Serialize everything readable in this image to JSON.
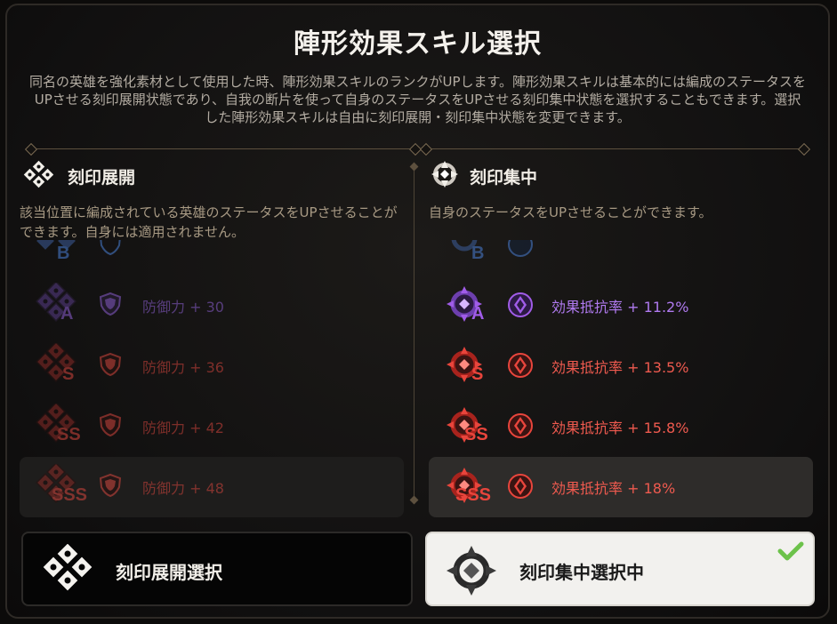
{
  "title": "陣形効果スキル選択",
  "description": "同名の英雄を強化素材として使用した時、陣形効果スキルのランクがUPします。陣形効果スキルは基本的には編成のステータスをUPさせる刻印展開状態であり、自我の断片を使って自身のステータスをUPさせる刻印集中状態を選択することもできます。選択した陣形効果スキルは自由に刻印展開・刻印集中状態を変更できます。",
  "left": {
    "label": "刻印展開",
    "icon": "diamond-cluster-icon",
    "desc": "該当位置に編成されている英雄のステータスをUPさせることができます。自身には適用されません。",
    "rows": [
      {
        "rank": "B",
        "stat": "",
        "color": "#4a7fd6",
        "partial": true
      },
      {
        "rank": "A",
        "stat": "防御力 + 30",
        "color": "#8d5fd3"
      },
      {
        "rank": "S",
        "stat": "防御力 + 36",
        "color": "#d4453d"
      },
      {
        "rank": "SS",
        "stat": "防御力 + 42",
        "color": "#d4453d"
      },
      {
        "rank": "SSS",
        "stat": "防御力 + 48",
        "color": "#d4453d",
        "selected": true
      }
    ]
  },
  "right": {
    "label": "刻印集中",
    "icon": "crosshair-icon",
    "desc": "自身のステータスをUPさせることができます。",
    "rows": [
      {
        "rank": "B",
        "stat": "",
        "color": "#4a7fd6",
        "partial": true
      },
      {
        "rank": "A",
        "stat": "効果抵抗率 + 11.2%",
        "color": "#a05ce8"
      },
      {
        "rank": "S",
        "stat": "効果抵抗率 + 13.5%",
        "color": "#e8453c"
      },
      {
        "rank": "SS",
        "stat": "効果抵抗率 + 15.8%",
        "color": "#e8453c"
      },
      {
        "rank": "SSS",
        "stat": "効果抵抗率 + 18%",
        "color": "#e8453c",
        "selected": true
      }
    ]
  },
  "buttons": {
    "left_label": "刻印展開選択",
    "right_label": "刻印集中選択中"
  },
  "colors": {
    "check": "#6cc24a",
    "divider": "#5d503e"
  }
}
